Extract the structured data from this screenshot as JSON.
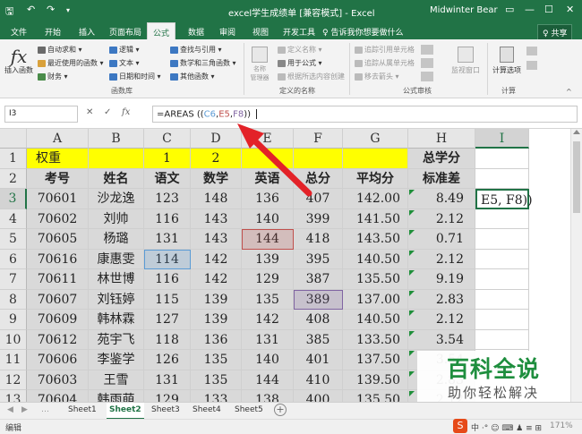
{
  "app": {
    "title": "excel学生成绩单 [兼容模式] - Excel",
    "user": "Midwinter Bear",
    "qa_save": "🖫",
    "qa_undo": "↶",
    "qa_redo": "↷",
    "qa_more": "▾",
    "win_restore": "▭",
    "win_min": "—",
    "win_max": "☐",
    "win_close": "✕"
  },
  "tabs": [
    "文件",
    "开始",
    "插入",
    "页面布局",
    "公式",
    "数据",
    "审阅",
    "视图",
    "开发工具"
  ],
  "search": "♀ 告诉我你想要做什么",
  "share": "♀ 共享",
  "ribbon": {
    "insert_fn": "插入函数",
    "fx": "fx",
    "autosum": "自动求和 ▾",
    "recent": "最近使用的函数 ▾",
    "finance": "财务 ▾",
    "logic": "逻辑 ▾",
    "text": "文本 ▾",
    "datetime": "日期和时间 ▾",
    "lookup": "查找与引用 ▾",
    "math": "数学和三角函数 ▾",
    "other": "其他函数 ▾",
    "lib_group": "函数库",
    "name_mgr": "名称\n管理器",
    "define_name": "定义名称 ▾",
    "use_in_formula": "用于公式 ▾",
    "create_from_sel": "根据所选内容创建",
    "names_group": "定义的名称",
    "trace_prec": "追踪引用单元格",
    "trace_dep": "追踪从属单元格",
    "remove_arrows": "移去箭头 ▾",
    "audit_group": "公式审核",
    "watch": "监视窗口",
    "calc_opts": "计算选项",
    "calc_group": "计算"
  },
  "colors": {
    "accent": "#217346",
    "yellow": "#ffff00",
    "band": "#d9d9d9",
    "blue_ref": "#5b9bd5",
    "red_ref": "#c0504d",
    "purple_ref": "#8064a2",
    "arrow": "#e32228"
  },
  "fxbar": {
    "namebox": "I3",
    "cancel": "✕",
    "enter": "✓",
    "fx": "fx",
    "formula": "=AREAS ((C6,E5,F8))"
  },
  "grid": {
    "cols": [
      "A",
      "B",
      "C",
      "D",
      "E",
      "F",
      "G",
      "H",
      "I"
    ],
    "rows": [
      "1",
      "2",
      "3",
      "4",
      "5",
      "6",
      "7",
      "8",
      "9",
      "10",
      "11",
      "12",
      "13"
    ],
    "row1": {
      "A": "权重",
      "C": "1",
      "D": "2",
      "H": "总学分"
    },
    "row2": [
      "考号",
      "姓名",
      "语文",
      "数学",
      "英语",
      "总分",
      "平均分",
      "标准差"
    ],
    "data": [
      [
        "70601",
        "沙龙逸",
        "123",
        "148",
        "136",
        "407",
        "142.00",
        "8.49"
      ],
      [
        "70602",
        "刘帅",
        "116",
        "143",
        "140",
        "399",
        "141.50",
        "2.12"
      ],
      [
        "70605",
        "杨璐",
        "131",
        "143",
        "144",
        "418",
        "143.50",
        "0.71"
      ],
      [
        "70616",
        "康惠雯",
        "114",
        "142",
        "139",
        "395",
        "140.50",
        "2.12"
      ],
      [
        "70611",
        "林世博",
        "116",
        "142",
        "129",
        "387",
        "135.50",
        "9.19"
      ],
      [
        "70607",
        "刘钰婷",
        "115",
        "139",
        "135",
        "389",
        "137.00",
        "2.83"
      ],
      [
        "70609",
        "韩林霖",
        "127",
        "139",
        "142",
        "408",
        "140.50",
        "2.12"
      ],
      [
        "70612",
        "苑宇飞",
        "118",
        "136",
        "131",
        "385",
        "133.50",
        "3.54"
      ],
      [
        "70606",
        "李鉴学",
        "126",
        "135",
        "140",
        "401",
        "137.50",
        "3.54"
      ],
      [
        "70603",
        "王雪",
        "131",
        "135",
        "144",
        "410",
        "139.50",
        "2.83"
      ],
      [
        "70604",
        "韩雨萌",
        "129",
        "133",
        "138",
        "400",
        "135.50",
        "2.12"
      ]
    ],
    "editing_cell": "E5, F8))"
  },
  "sheets": [
    "Sheet1",
    "Sheet2",
    "Sheet3",
    "Sheet4",
    "Sheet5"
  ],
  "status": {
    "mode": "编辑",
    "zoom": "171%",
    "tray": "中 ·° ☺ ⌨ ♟ ≡ ⊞"
  },
  "watermark": {
    "line1": "百科全说",
    "line2": "助你轻松解决"
  }
}
